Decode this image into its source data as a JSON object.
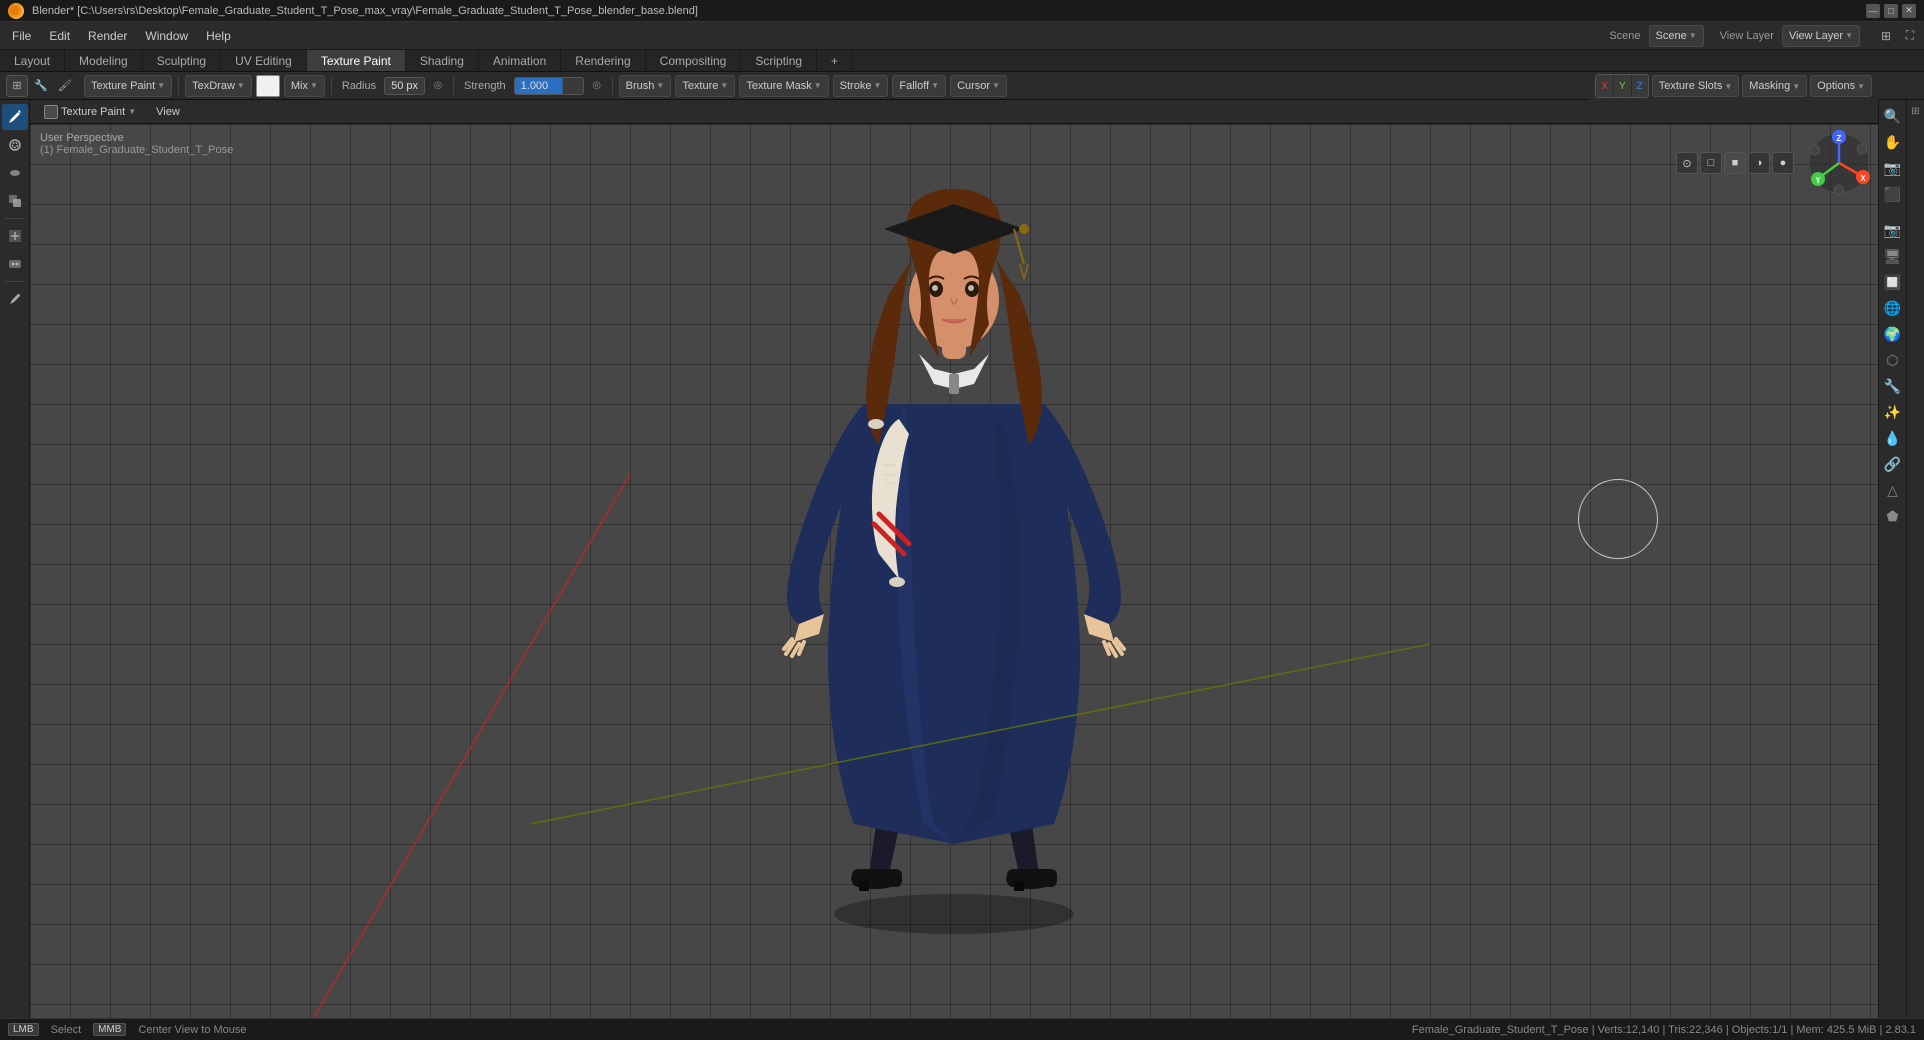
{
  "window": {
    "title": "Blender* [C:\\Users\\rs\\Desktop\\Female_Graduate_Student_T_Pose_max_vray\\Female_Graduate_Student_T_Pose_blender_base.blend]"
  },
  "menu": {
    "items": [
      "File",
      "Edit",
      "Render",
      "Window",
      "Help"
    ],
    "scene_label": "Scene",
    "view_layer_label": "View Layer",
    "plus_btn": "+"
  },
  "workspace_tabs": [
    {
      "label": "Layout",
      "active": false
    },
    {
      "label": "Modeling",
      "active": false
    },
    {
      "label": "Sculpting",
      "active": false
    },
    {
      "label": "UV Editing",
      "active": false
    },
    {
      "label": "Texture Paint",
      "active": true
    },
    {
      "label": "Shading",
      "active": false
    },
    {
      "label": "Animation",
      "active": false
    },
    {
      "label": "Rendering",
      "active": false
    },
    {
      "label": "Compositing",
      "active": false
    },
    {
      "label": "Scripting",
      "active": false
    },
    {
      "label": "+",
      "active": false
    }
  ],
  "header": {
    "mode_label": "Texture Paint",
    "brush_name": "TexDraw",
    "blend_mode": "Mix",
    "radius_label": "Radius",
    "radius_value": "50 px",
    "strength_label": "Strength",
    "strength_value": "1.000",
    "brush_label": "Brush",
    "texture_label": "Texture",
    "texture_mask_label": "Texture Mask",
    "stroke_label": "Stroke",
    "falloff_label": "Falloff",
    "cursor_label": "Cursor"
  },
  "view_toolbar": {
    "paint_label": "Texture Paint",
    "view_label": "View"
  },
  "viewport": {
    "perspective_label": "User Perspective",
    "object_label": "(1) Female_Graduate_Student_T_Pose"
  },
  "header_right": {
    "scene_name": "Scene",
    "view_layer_name": "View Layer",
    "texture_slots_label": "Texture Slots",
    "masking_label": "Masking",
    "options_label": "Options"
  },
  "status_bar": {
    "select_label": "Select",
    "center_view_label": "Center View to Mouse",
    "info": "Female_Graduate_Student_T_Pose | Verts:12,140 | Tris:22,346 | Objects:1/1 | Mem: 425.5 MiB | 2.83.1"
  },
  "left_tools": [
    {
      "icon": "✏",
      "name": "draw-tool",
      "active": true
    },
    {
      "icon": "○",
      "name": "soften-tool",
      "active": false
    },
    {
      "icon": "◎",
      "name": "smear-tool",
      "active": false
    },
    {
      "icon": "⊕",
      "name": "clone-tool",
      "active": false
    },
    {
      "icon": "△",
      "name": "fill-tool",
      "active": false
    },
    {
      "icon": "▨",
      "name": "mask-tool",
      "active": false
    },
    {
      "divider": true
    },
    {
      "icon": "⬡",
      "name": "annotate-tool",
      "active": false
    }
  ],
  "props_icons": [
    "camera",
    "scene",
    "world",
    "object",
    "particles",
    "physics",
    "constraints",
    "data",
    "material",
    "texture"
  ],
  "nav_gizmo": {
    "x_label": "X",
    "y_label": "Y",
    "z_label": "Z"
  }
}
